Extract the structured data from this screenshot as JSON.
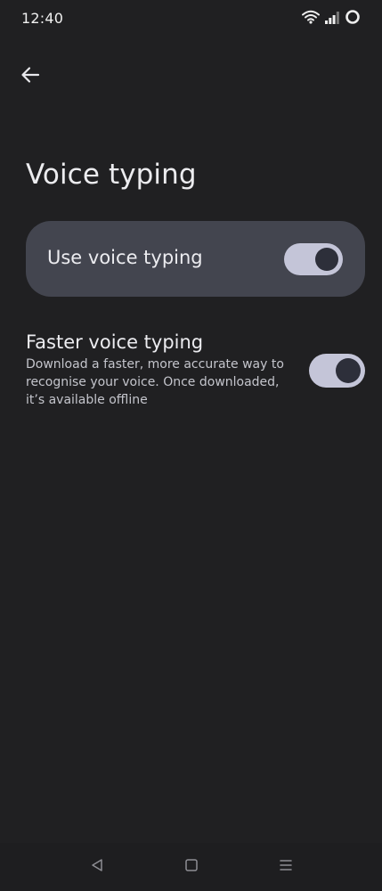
{
  "status_bar": {
    "time": "12:40",
    "icons": [
      "wifi-icon",
      "signal-icon",
      "battery-ring-icon"
    ]
  },
  "header": {
    "back_icon": "arrow-left-icon",
    "title": "Voice typing"
  },
  "main_setting": {
    "label": "Use voice typing",
    "enabled": true
  },
  "faster_setting": {
    "title": "Faster voice typing",
    "description": "Download a faster, more accurate way to recognise your voice. Once downloaded, it’s available offline",
    "enabled": true
  },
  "nav_bar": {
    "icons": [
      "back-triangle-icon",
      "home-square-icon",
      "menu-lines-icon"
    ]
  },
  "colors": {
    "background": "#202022",
    "card": "#43454f",
    "toggle_track": "#c4c5d8",
    "toggle_knob": "#2d2f3a"
  }
}
